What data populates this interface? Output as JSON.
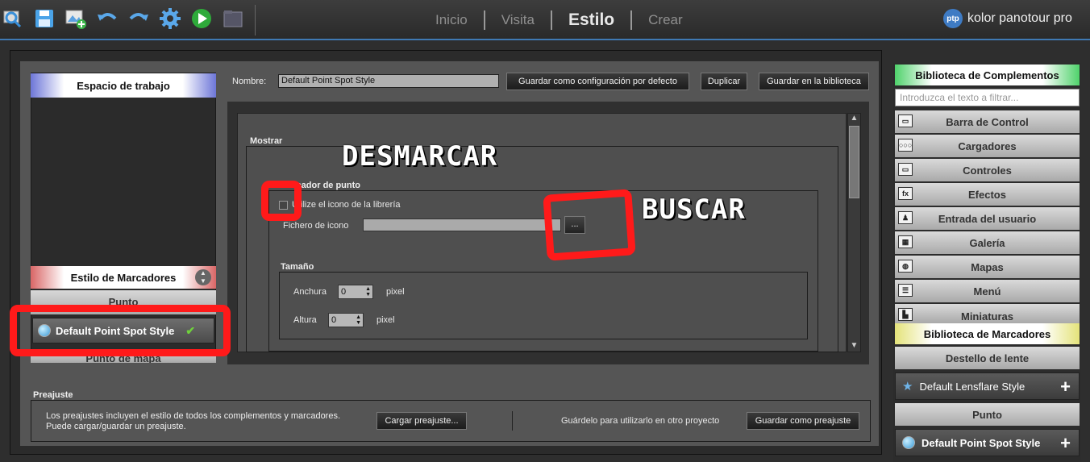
{
  "toolbar": {
    "icons": [
      "search-panorama-icon",
      "save-icon",
      "add-image-icon",
      "undo-icon",
      "redo-icon",
      "settings-gear-icon",
      "play-icon",
      "preview-icon"
    ]
  },
  "nav": {
    "tabs": [
      "Inicio",
      "Visita",
      "Estilo",
      "Crear"
    ],
    "active": "Estilo"
  },
  "brand": {
    "logo": "ptp",
    "name": "kolor panotour pro"
  },
  "left": {
    "workspace_header": "Espacio de trabajo",
    "markers_header": "Estilo de Marcadores",
    "spinner": "▲\n▼",
    "punto": "Punto",
    "selected_style": "Default Point Spot Style",
    "punto_mapa": "Punto de mapa"
  },
  "nombre": {
    "label": "Nombre:",
    "value": "Default Point Spot Style",
    "btn_default": "Guardar como configuración por defecto",
    "btn_duplicate": "Duplicar",
    "btn_library": "Guardar en la biblioteca"
  },
  "editor": {
    "mostrar": "Mostrar",
    "marcador": "Marcador de punto",
    "use_library_icon": "Utilize el icono de la librería",
    "icon_file": "Fichero de icono",
    "browse": "...",
    "size": "Tamaño",
    "width_label": "Anchura",
    "width_value": "0",
    "height_label": "Altura",
    "height_value": "0",
    "unit": "pixel",
    "scroll_up": "▲",
    "scroll_down": "▼"
  },
  "annotations": {
    "uncheck": "DESMARCAR",
    "search": "BUSCAR"
  },
  "preset": {
    "label": "Preajuste",
    "text1": "Los preajustes incluyen el estilo de todos los complementos y marcadores.",
    "text2": "Puede cargar/guardar un preajuste.",
    "load_btn": "Cargar preajuste...",
    "save_text": "Guárdelo para utilizarlo en otro proyecto",
    "save_btn": "Guardar como preajuste"
  },
  "right": {
    "plugins_header": "Biblioteca de Complementos",
    "filter_placeholder": "Introduzca el texto a filtrar...",
    "plugins": [
      {
        "label": "Barra de Control",
        "icon": "▭"
      },
      {
        "label": "Cargadores",
        "icon": "○○○"
      },
      {
        "label": "Controles",
        "icon": "▭"
      },
      {
        "label": "Efectos",
        "icon": "fx"
      },
      {
        "label": "Entrada del usuario",
        "icon": "♟"
      },
      {
        "label": "Galería",
        "icon": "▦"
      },
      {
        "label": "Mapas",
        "icon": "◍"
      },
      {
        "label": "Menú",
        "icon": "☰"
      },
      {
        "label": "Miniaturas",
        "icon": "▙"
      }
    ],
    "markers_header": "Biblioteca de Marcadores",
    "lens_section": "Destello de lente",
    "lens_style": "Default Lensflare Style",
    "point_section": "Punto",
    "point_style": "Default Point Spot Style",
    "plus": "+"
  },
  "colors": {
    "accent_blue": "#3f79b3",
    "plugins_header_green": "#4fd26b",
    "markers_header_yellow": "#e4e37a",
    "annotation_red": "#ff1a1a"
  }
}
